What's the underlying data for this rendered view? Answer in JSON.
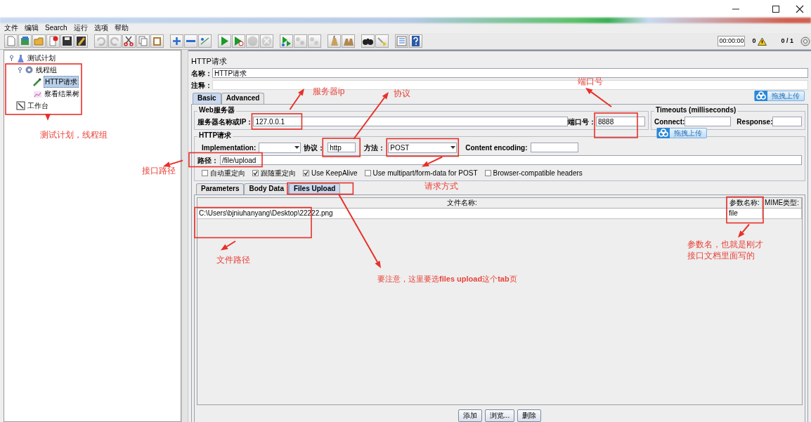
{
  "menu": [
    "文件",
    "编辑",
    "Search",
    "运行",
    "选项",
    "帮助"
  ],
  "toolbar": [
    {
      "disabled": false
    },
    {
      "disabled": false
    },
    {
      "disabled": false
    },
    {
      "disabled": false
    },
    {
      "disabled": false
    },
    {
      "disabled": false
    },
    {
      "disabled": true
    },
    {
      "disabled": true
    },
    {
      "disabled": false
    },
    {
      "disabled": false
    },
    {
      "disabled": false
    },
    {
      "disabled": false
    },
    {
      "disabled": false
    },
    {
      "disabled": false
    },
    {
      "disabled": false
    },
    {
      "disabled": false
    },
    {
      "disabled": true
    },
    {
      "disabled": true
    },
    {
      "disabled": false
    },
    {
      "disabled": true
    },
    {
      "disabled": true
    },
    {
      "disabled": false
    },
    {
      "disabled": false
    },
    {
      "disabled": false
    },
    {
      "disabled": false
    },
    {
      "disabled": false
    },
    {
      "disabled": false
    }
  ],
  "status": {
    "timer": "00:00:00",
    "warnings": "0",
    "threads": "0 / 1"
  },
  "tree": [
    {
      "label": "测试计划",
      "kind": "plan",
      "selected": false,
      "expanded": true,
      "children": [
        {
          "label": "线程组",
          "kind": "thread-group",
          "selected": false,
          "expanded": true,
          "children": [
            {
              "label": "HTTP请求",
              "kind": "sampler",
              "selected": true
            },
            {
              "label": "察看结果树",
              "kind": "listener",
              "selected": false
            }
          ]
        }
      ]
    },
    {
      "label": "工作台",
      "kind": "workbench",
      "selected": false
    }
  ],
  "panel_title": "HTTP请求",
  "name_field": {
    "label": "名称：",
    "value": "HTTP请求"
  },
  "comment_field": {
    "label": "注释："
  },
  "config_tabs": [
    {
      "label": "Basic",
      "selected": true
    },
    {
      "label": "Advanced",
      "selected": false
    }
  ],
  "web_server": {
    "title": "Web服务器",
    "server_label": "服务器名称或IP：",
    "server": "127.0.0.1",
    "port_label": "端口号：",
    "port": "8888"
  },
  "timeouts": {
    "title": "Timeouts (milliseconds)",
    "connect_label": "Connect:",
    "response_label": "Response:"
  },
  "http_request": {
    "title": "HTTP请求",
    "implementation_label": "Implementation:",
    "protocol_label": "协议：",
    "protocol": "http",
    "method_label": "方法：",
    "method": "POST",
    "encoding_label": "Content encoding:",
    "path_label": "路径：",
    "path": "/file/upload"
  },
  "options": [
    {
      "label": "自动重定向",
      "checked": false
    },
    {
      "label": "跟随重定向",
      "checked": true
    },
    {
      "label": "Use KeepAlive",
      "checked": true
    },
    {
      "label": "Use multipart/form-data for POST",
      "checked": false
    },
    {
      "label": "Browser-compatible headers",
      "checked": false
    }
  ],
  "body_tabs": [
    {
      "label": "Parameters",
      "selected": false
    },
    {
      "label": "Body Data",
      "selected": false
    },
    {
      "label": "Files Upload",
      "selected": true
    }
  ],
  "files_table": {
    "columns": [
      "文件名称:",
      "参数名称:",
      "MIME类型:"
    ],
    "rows": [
      {
        "path": "C:\\Users\\bjniuhanyang\\Desktop\\22222.png",
        "param": "file"
      }
    ]
  },
  "table_buttons": [
    "添加",
    "浏览...",
    "删除"
  ],
  "upload_overlays": [
    "拖拽上传",
    "拖拽上传"
  ],
  "annotations": [
    "测试计划，线程组",
    "服务器ip",
    "协议",
    "端口号",
    "接口路径",
    "请求方式",
    "文件路径",
    "要注意，这里要选**files upload**这个**tab**页",
    "参数名，也就是刚才接口文档里面写的"
  ]
}
